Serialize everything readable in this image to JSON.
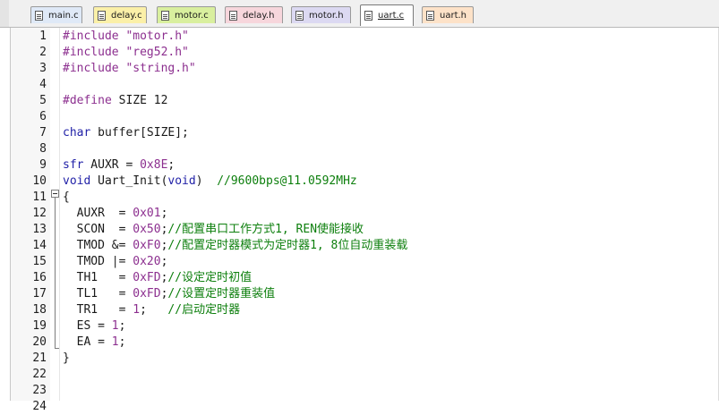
{
  "tabs": [
    {
      "label": "main.c",
      "color": "#dfe9f7",
      "icon": "file-c-icon",
      "active": false
    },
    {
      "label": "delay.c",
      "color": "#fbf0a8",
      "icon": "file-c-icon",
      "active": false
    },
    {
      "label": "motor.c",
      "color": "#d9ef9e",
      "icon": "file-c-icon",
      "active": false
    },
    {
      "label": "delay.h",
      "color": "#f7d6dc",
      "icon": "file-h-icon",
      "active": false
    },
    {
      "label": "motor.h",
      "color": "#dcd9f2",
      "icon": "file-h-icon",
      "active": false
    },
    {
      "label": "uart.c",
      "color": "#ffffff",
      "icon": "file-c-icon",
      "active": true
    },
    {
      "label": "uart.h",
      "color": "#fde2c8",
      "icon": "file-h-icon",
      "active": false
    }
  ],
  "editor": {
    "lines": [
      {
        "n": "1",
        "tokens": [
          [
            "pp",
            "#include \"motor.h\""
          ]
        ]
      },
      {
        "n": "2",
        "tokens": [
          [
            "pp",
            "#include \"reg52.h\""
          ]
        ]
      },
      {
        "n": "3",
        "tokens": [
          [
            "pp",
            "#include \"string.h\""
          ]
        ]
      },
      {
        "n": "4",
        "tokens": []
      },
      {
        "n": "5",
        "tokens": [
          [
            "pp",
            "#define"
          ],
          [
            "tx",
            " SIZE 12"
          ]
        ]
      },
      {
        "n": "6",
        "tokens": []
      },
      {
        "n": "7",
        "tokens": [
          [
            "kw",
            "char"
          ],
          [
            "tx",
            " buffer[SIZE];"
          ]
        ]
      },
      {
        "n": "8",
        "tokens": []
      },
      {
        "n": "9",
        "tokens": [
          [
            "kw",
            "sfr"
          ],
          [
            "tx",
            " AUXR = "
          ],
          [
            "num",
            "0x8E"
          ],
          [
            "tx",
            ";"
          ]
        ]
      },
      {
        "n": "10",
        "tokens": [
          [
            "kw",
            "void"
          ],
          [
            "tx",
            " Uart_Init("
          ],
          [
            "kw",
            "void"
          ],
          [
            "tx",
            ")  "
          ],
          [
            "cm",
            "//9600bps@11.0592MHz"
          ]
        ]
      },
      {
        "n": "11",
        "tokens": [
          [
            "tx",
            "{"
          ]
        ]
      },
      {
        "n": "12",
        "tokens": [
          [
            "tx",
            "  AUXR  = "
          ],
          [
            "num",
            "0x01"
          ],
          [
            "tx",
            ";"
          ]
        ]
      },
      {
        "n": "13",
        "tokens": [
          [
            "tx",
            "  SCON  = "
          ],
          [
            "num",
            "0x50"
          ],
          [
            "tx",
            ";"
          ],
          [
            "cm",
            "//配置串口工作方式1, REN使能接收"
          ]
        ]
      },
      {
        "n": "14",
        "tokens": [
          [
            "tx",
            "  TMOD &= "
          ],
          [
            "num",
            "0xF0"
          ],
          [
            "tx",
            ";"
          ],
          [
            "cm",
            "//配置定时器模式为定时器1, 8位自动重装载"
          ]
        ]
      },
      {
        "n": "15",
        "tokens": [
          [
            "tx",
            "  TMOD |= "
          ],
          [
            "num",
            "0x20"
          ],
          [
            "tx",
            ";"
          ]
        ]
      },
      {
        "n": "16",
        "tokens": [
          [
            "tx",
            "  TH1   = "
          ],
          [
            "num",
            "0xFD"
          ],
          [
            "tx",
            ";"
          ],
          [
            "cm",
            "//设定定时初值"
          ]
        ]
      },
      {
        "n": "17",
        "tokens": [
          [
            "tx",
            "  TL1   = "
          ],
          [
            "num",
            "0xFD"
          ],
          [
            "tx",
            ";"
          ],
          [
            "cm",
            "//设置定时器重装值"
          ]
        ]
      },
      {
        "n": "18",
        "tokens": [
          [
            "tx",
            "  TR1   = "
          ],
          [
            "num",
            "1"
          ],
          [
            "tx",
            ";   "
          ],
          [
            "cm",
            "//启动定时器"
          ]
        ]
      },
      {
        "n": "19",
        "tokens": [
          [
            "tx",
            "  ES = "
          ],
          [
            "num",
            "1"
          ],
          [
            "tx",
            ";"
          ]
        ]
      },
      {
        "n": "20",
        "tokens": [
          [
            "tx",
            "  EA = "
          ],
          [
            "num",
            "1"
          ],
          [
            "tx",
            ";"
          ]
        ]
      },
      {
        "n": "21",
        "tokens": [
          [
            "tx",
            "}"
          ]
        ]
      },
      {
        "n": "22",
        "tokens": []
      },
      {
        "n": "23",
        "tokens": []
      },
      {
        "n": "24",
        "tokens": []
      }
    ]
  }
}
